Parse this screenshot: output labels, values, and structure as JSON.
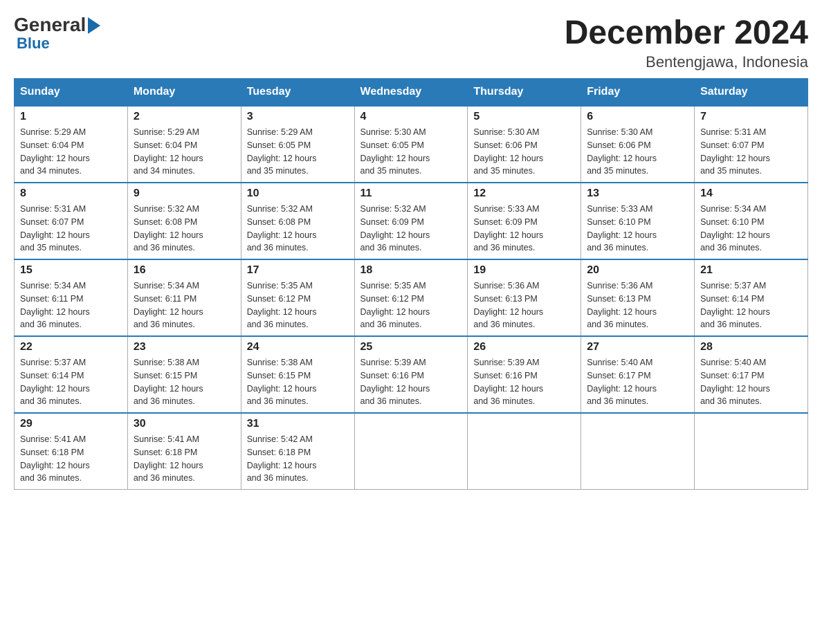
{
  "header": {
    "logo_general": "General",
    "logo_blue": "Blue",
    "month_title": "December 2024",
    "location": "Bentengjawa, Indonesia"
  },
  "days_of_week": [
    "Sunday",
    "Monday",
    "Tuesday",
    "Wednesday",
    "Thursday",
    "Friday",
    "Saturday"
  ],
  "weeks": [
    [
      {
        "day": "1",
        "sunrise": "5:29 AM",
        "sunset": "6:04 PM",
        "daylight": "12 hours and 34 minutes."
      },
      {
        "day": "2",
        "sunrise": "5:29 AM",
        "sunset": "6:04 PM",
        "daylight": "12 hours and 34 minutes."
      },
      {
        "day": "3",
        "sunrise": "5:29 AM",
        "sunset": "6:05 PM",
        "daylight": "12 hours and 35 minutes."
      },
      {
        "day": "4",
        "sunrise": "5:30 AM",
        "sunset": "6:05 PM",
        "daylight": "12 hours and 35 minutes."
      },
      {
        "day": "5",
        "sunrise": "5:30 AM",
        "sunset": "6:06 PM",
        "daylight": "12 hours and 35 minutes."
      },
      {
        "day": "6",
        "sunrise": "5:30 AM",
        "sunset": "6:06 PM",
        "daylight": "12 hours and 35 minutes."
      },
      {
        "day": "7",
        "sunrise": "5:31 AM",
        "sunset": "6:07 PM",
        "daylight": "12 hours and 35 minutes."
      }
    ],
    [
      {
        "day": "8",
        "sunrise": "5:31 AM",
        "sunset": "6:07 PM",
        "daylight": "12 hours and 35 minutes."
      },
      {
        "day": "9",
        "sunrise": "5:32 AM",
        "sunset": "6:08 PM",
        "daylight": "12 hours and 36 minutes."
      },
      {
        "day": "10",
        "sunrise": "5:32 AM",
        "sunset": "6:08 PM",
        "daylight": "12 hours and 36 minutes."
      },
      {
        "day": "11",
        "sunrise": "5:32 AM",
        "sunset": "6:09 PM",
        "daylight": "12 hours and 36 minutes."
      },
      {
        "day": "12",
        "sunrise": "5:33 AM",
        "sunset": "6:09 PM",
        "daylight": "12 hours and 36 minutes."
      },
      {
        "day": "13",
        "sunrise": "5:33 AM",
        "sunset": "6:10 PM",
        "daylight": "12 hours and 36 minutes."
      },
      {
        "day": "14",
        "sunrise": "5:34 AM",
        "sunset": "6:10 PM",
        "daylight": "12 hours and 36 minutes."
      }
    ],
    [
      {
        "day": "15",
        "sunrise": "5:34 AM",
        "sunset": "6:11 PM",
        "daylight": "12 hours and 36 minutes."
      },
      {
        "day": "16",
        "sunrise": "5:34 AM",
        "sunset": "6:11 PM",
        "daylight": "12 hours and 36 minutes."
      },
      {
        "day": "17",
        "sunrise": "5:35 AM",
        "sunset": "6:12 PM",
        "daylight": "12 hours and 36 minutes."
      },
      {
        "day": "18",
        "sunrise": "5:35 AM",
        "sunset": "6:12 PM",
        "daylight": "12 hours and 36 minutes."
      },
      {
        "day": "19",
        "sunrise": "5:36 AM",
        "sunset": "6:13 PM",
        "daylight": "12 hours and 36 minutes."
      },
      {
        "day": "20",
        "sunrise": "5:36 AM",
        "sunset": "6:13 PM",
        "daylight": "12 hours and 36 minutes."
      },
      {
        "day": "21",
        "sunrise": "5:37 AM",
        "sunset": "6:14 PM",
        "daylight": "12 hours and 36 minutes."
      }
    ],
    [
      {
        "day": "22",
        "sunrise": "5:37 AM",
        "sunset": "6:14 PM",
        "daylight": "12 hours and 36 minutes."
      },
      {
        "day": "23",
        "sunrise": "5:38 AM",
        "sunset": "6:15 PM",
        "daylight": "12 hours and 36 minutes."
      },
      {
        "day": "24",
        "sunrise": "5:38 AM",
        "sunset": "6:15 PM",
        "daylight": "12 hours and 36 minutes."
      },
      {
        "day": "25",
        "sunrise": "5:39 AM",
        "sunset": "6:16 PM",
        "daylight": "12 hours and 36 minutes."
      },
      {
        "day": "26",
        "sunrise": "5:39 AM",
        "sunset": "6:16 PM",
        "daylight": "12 hours and 36 minutes."
      },
      {
        "day": "27",
        "sunrise": "5:40 AM",
        "sunset": "6:17 PM",
        "daylight": "12 hours and 36 minutes."
      },
      {
        "day": "28",
        "sunrise": "5:40 AM",
        "sunset": "6:17 PM",
        "daylight": "12 hours and 36 minutes."
      }
    ],
    [
      {
        "day": "29",
        "sunrise": "5:41 AM",
        "sunset": "6:18 PM",
        "daylight": "12 hours and 36 minutes."
      },
      {
        "day": "30",
        "sunrise": "5:41 AM",
        "sunset": "6:18 PM",
        "daylight": "12 hours and 36 minutes."
      },
      {
        "day": "31",
        "sunrise": "5:42 AM",
        "sunset": "6:18 PM",
        "daylight": "12 hours and 36 minutes."
      },
      null,
      null,
      null,
      null
    ]
  ],
  "labels": {
    "sunrise": "Sunrise:",
    "sunset": "Sunset:",
    "daylight": "Daylight:"
  }
}
